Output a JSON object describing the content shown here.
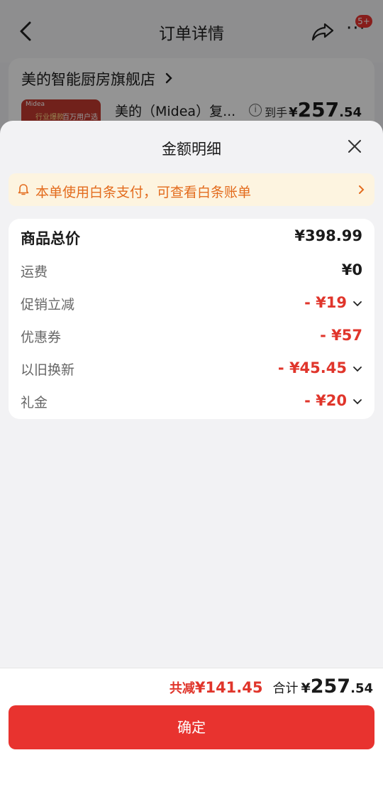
{
  "background": {
    "nav_title": "订单详情",
    "more_badge": "5+",
    "store_name": "美的智能厨房旗舰店",
    "product_name": "美的（Midea）复...",
    "product_thumb_text": {
      "brand": "Midea",
      "tag1": "行业爆款",
      "tag2": "百万用户选择"
    },
    "price_label": "到手",
    "price_currency": "¥",
    "price_int": "257",
    "price_dec": ".54"
  },
  "sheet": {
    "title": "金额明细",
    "notice": "本单使用白条支付，可查看白条账单",
    "rows": [
      {
        "label": "商品总价",
        "value": "¥398.99"
      },
      {
        "label": "运费",
        "value": "¥0"
      },
      {
        "label": "促销立减",
        "value": "- ¥19"
      },
      {
        "label": "优惠券",
        "value": "- ¥57"
      },
      {
        "label": "以旧换新",
        "value": "- ¥45.45"
      },
      {
        "label": "礼金",
        "value": "- ¥20"
      }
    ]
  },
  "footer": {
    "save_label": "共减",
    "save_value": "¥141.45",
    "total_label": "合计",
    "total_currency": "¥",
    "total_int": "257",
    "total_dec": ".54",
    "confirm_label": "确定"
  },
  "colors": {
    "accent_red": "#e8332f",
    "notice_bg": "#fdf4e0",
    "notice_text": "#e36b1d"
  }
}
